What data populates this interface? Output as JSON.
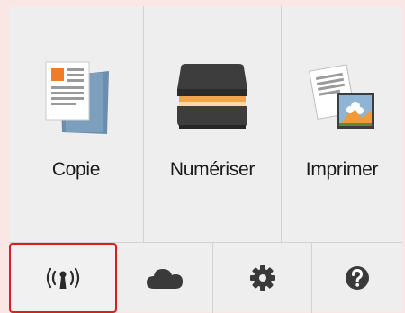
{
  "tiles": [
    {
      "label": "Copie",
      "icon": "copy-icon"
    },
    {
      "label": "Numériser",
      "icon": "scanner-icon"
    },
    {
      "label": "Imprimer",
      "icon": "print-photo-icon"
    }
  ],
  "bottom_bar": {
    "wireless": {
      "icon": "wireless-icon",
      "selected": true
    },
    "cloud": {
      "icon": "cloud-icon"
    },
    "settings": {
      "icon": "gear-icon"
    },
    "help": {
      "icon": "help-icon"
    }
  },
  "colors": {
    "highlight": "#d62020",
    "panel": "#eeeeee",
    "icon_dark": "#3a3a3a",
    "accent_orange": "#f09a3a",
    "accent_blue": "#6a8fb1"
  }
}
